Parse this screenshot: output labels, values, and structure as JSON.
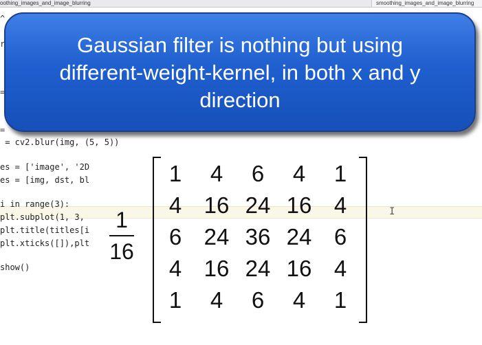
{
  "tabs": {
    "left_label": "oothing_images_and_image_blurring",
    "right_label": "smoothing_images_and_image_blurring"
  },
  "code_lines": [
    {
      "text": " = cv2.blur(img, (5, 5))"
    },
    {
      "text": "es = ['image', '2D"
    },
    {
      "text": "es = [img, dst, bl"
    },
    {
      "text": "i in range(3):"
    },
    {
      "text": "plt.subplot(1, 3,"
    },
    {
      "text": "plt.title(titles[i"
    },
    {
      "text": "plt.xticks([]),plt"
    },
    {
      "text": "show()"
    }
  ],
  "left_fragments": [
    "^",
    "r",
    "=",
    "="
  ],
  "callout": {
    "text": "Gaussian filter is nothing but using different-weight-kernel, in both x and y direction"
  },
  "kernel": {
    "numerator": "1",
    "denominator": "16",
    "rows": [
      [
        "1",
        "4",
        "6",
        "4",
        "1"
      ],
      [
        "4",
        "16",
        "24",
        "16",
        "4"
      ],
      [
        "6",
        "24",
        "36",
        "24",
        "6"
      ],
      [
        "4",
        "16",
        "24",
        "16",
        "4"
      ],
      [
        "1",
        "4",
        "6",
        "4",
        "1"
      ]
    ]
  },
  "cursor_glyph": "I"
}
